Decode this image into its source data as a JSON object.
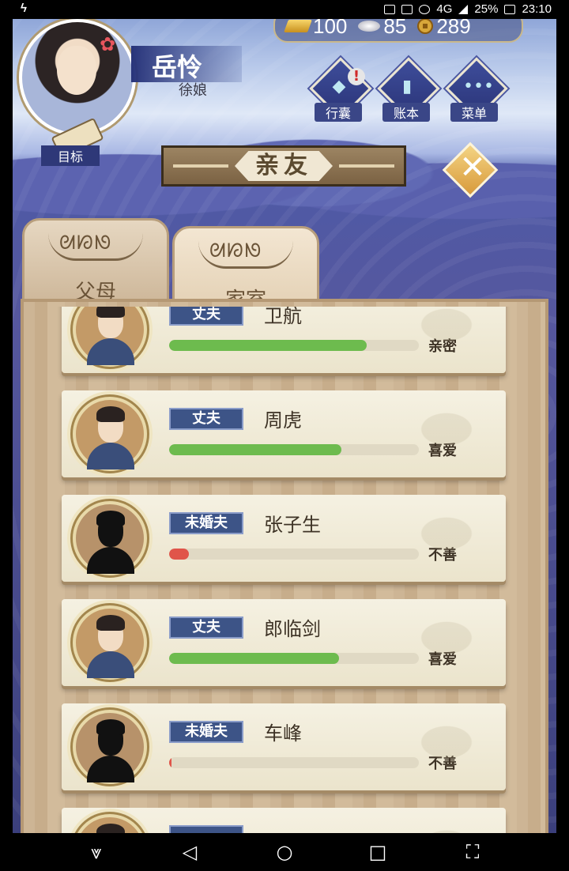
{
  "status_bar": {
    "left_icon": "ϟ",
    "battery": "25%",
    "network": "4G",
    "time": "23:10"
  },
  "currency": {
    "gold": "100",
    "silver": "85",
    "coins": "289"
  },
  "player": {
    "name": "岳怜",
    "title": "徐娘"
  },
  "goal_label": "目标",
  "menu": [
    {
      "label": "行囊",
      "icon": "bag-icon",
      "alert": "!"
    },
    {
      "label": "账本",
      "icon": "ledger-icon"
    },
    {
      "label": "菜单",
      "icon": "more-icon",
      "glyph": "•••"
    }
  ],
  "title": "亲友",
  "close_glyph": "✕",
  "tabs": [
    {
      "label": "父母",
      "active": false
    },
    {
      "label": "家室",
      "active": true
    }
  ],
  "relations": [
    {
      "role": "丈夫",
      "name": "卫航",
      "status": "亲密",
      "level": 0.79,
      "color": "#6dbb4e",
      "silhouette": false
    },
    {
      "role": "丈夫",
      "name": "周虎",
      "status": "喜爱",
      "level": 0.69,
      "color": "#6dbb4e",
      "silhouette": false
    },
    {
      "role": "未婚夫",
      "name": "张子生",
      "status": "不善",
      "level": 0.08,
      "color": "#e0554a",
      "silhouette": true
    },
    {
      "role": "丈夫",
      "name": "郎临剑",
      "status": "喜爱",
      "level": 0.68,
      "color": "#6dbb4e",
      "silhouette": false
    },
    {
      "role": "未婚夫",
      "name": "车峰",
      "status": "不善",
      "level": 0.01,
      "color": "#e0554a",
      "silhouette": true
    },
    {
      "role": "",
      "name": "",
      "status": "",
      "level": 0,
      "color": "#6dbb4e",
      "silhouette": false
    }
  ],
  "nav": {
    "down": "⩔",
    "back": "◁",
    "home": "○",
    "recents": "□",
    "screenshot": "⛶"
  }
}
